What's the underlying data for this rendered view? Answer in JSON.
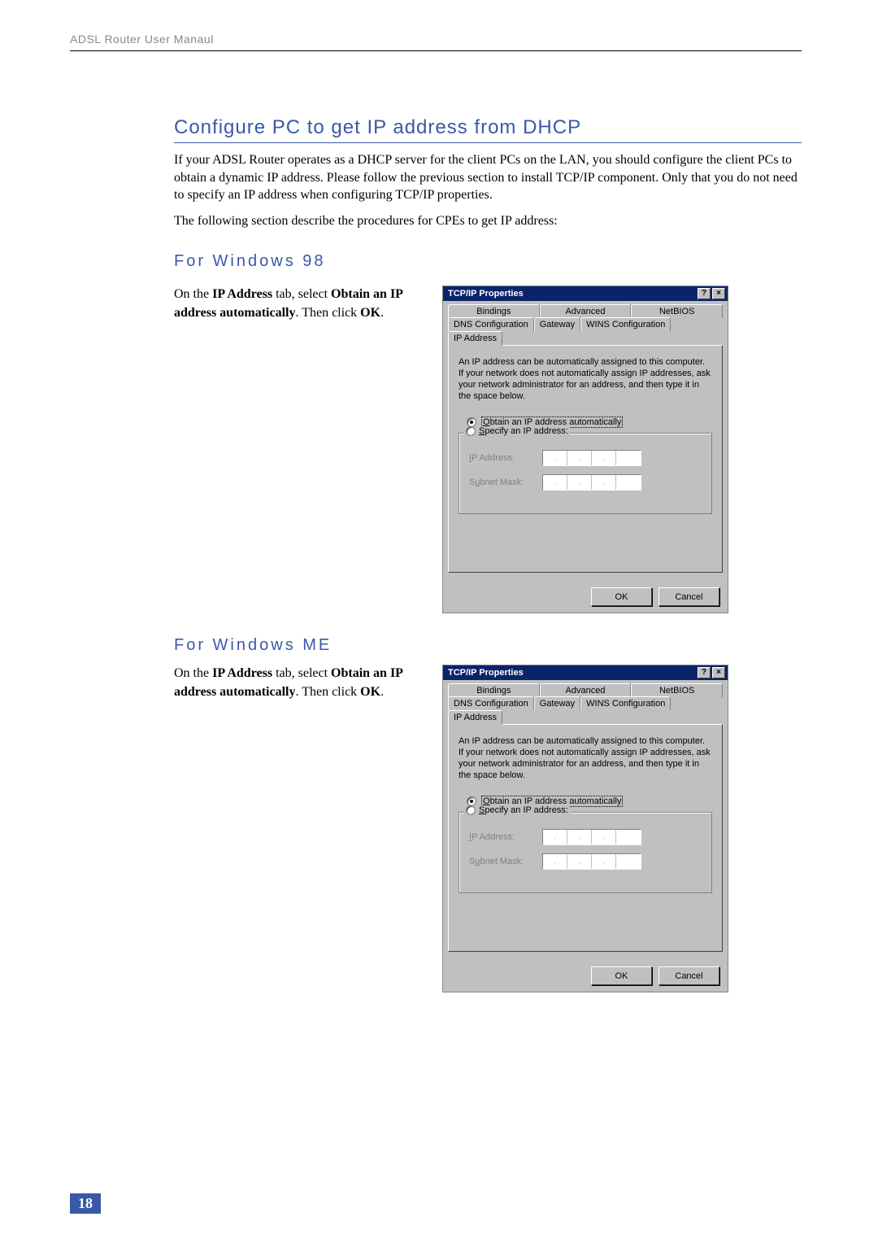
{
  "header": {
    "running_title": "ADSL Router User Manaul"
  },
  "section": {
    "title": "Configure PC to get IP address from DHCP",
    "p1": "If your ADSL Router operates as a DHCP server for the client PCs on the LAN, you should configure the client PCs to obtain a dynamic IP address. Please follow the previous section to install TCP/IP component. Only that you do not need to specify an IP address when configuring TCP/IP properties.",
    "p2": "The following section describe the procedures for CPEs to get IP address:"
  },
  "win98": {
    "heading": "For Windows 98",
    "instr_pre": "On the ",
    "instr_b1": "IP Address",
    "instr_mid": " tab, select ",
    "instr_b2": "Obtain an IP address automatically",
    "instr_post1": ". Then click ",
    "instr_b3": "OK",
    "instr_post2": "."
  },
  "winme": {
    "heading": "For Windows ME",
    "instr_pre": "On the ",
    "instr_b1": "IP Address",
    "instr_mid": " tab, select ",
    "instr_b2": "Obtain an IP address automatically",
    "instr_post1": ". Then click ",
    "instr_b3": "OK",
    "instr_post2": "."
  },
  "dialog": {
    "title": "TCP/IP Properties",
    "help_glyph": "?",
    "close_glyph": "×",
    "tabs_row1": [
      "Bindings",
      "Advanced",
      "NetBIOS"
    ],
    "tabs_row2": [
      "DNS Configuration",
      "Gateway",
      "WINS Configuration",
      "IP Address"
    ],
    "info": "An IP address can be automatically assigned to this computer. If your network does not automatically assign IP addresses, ask your network administrator for an address, and then type it in the space below.",
    "opt_auto_prefix": "O",
    "opt_auto_rest": "btain an IP address automatically",
    "opt_spec_prefix": "S",
    "opt_spec_rest": "pecify an IP address:",
    "ip_label_prefix": "I",
    "ip_label_rest": "P Address:",
    "mask_label_pre": "S",
    "mask_label_mid": "u",
    "mask_label_rest": "bnet Mask:",
    "ok": "OK",
    "cancel": "Cancel"
  },
  "footer": {
    "page": "18"
  }
}
